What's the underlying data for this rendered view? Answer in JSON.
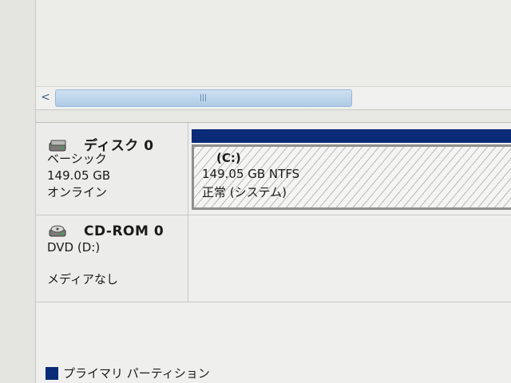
{
  "scrollbar": {
    "left_arrow": "<"
  },
  "disks": [
    {
      "name": "ディスク 0",
      "type": "ベーシック",
      "size": "149.05 GB",
      "status": "オンライン",
      "partition": {
        "letter": "(C:)",
        "size_fs": "149.05 GB NTFS",
        "status": "正常 (システム)"
      }
    },
    {
      "name": "CD-ROM 0",
      "type": "DVD (D:)",
      "status": "メディアなし"
    }
  ],
  "legend": {
    "primary_partition": "プライマリ パーティション"
  },
  "colors": {
    "primary_partition": "#0b2a78"
  }
}
